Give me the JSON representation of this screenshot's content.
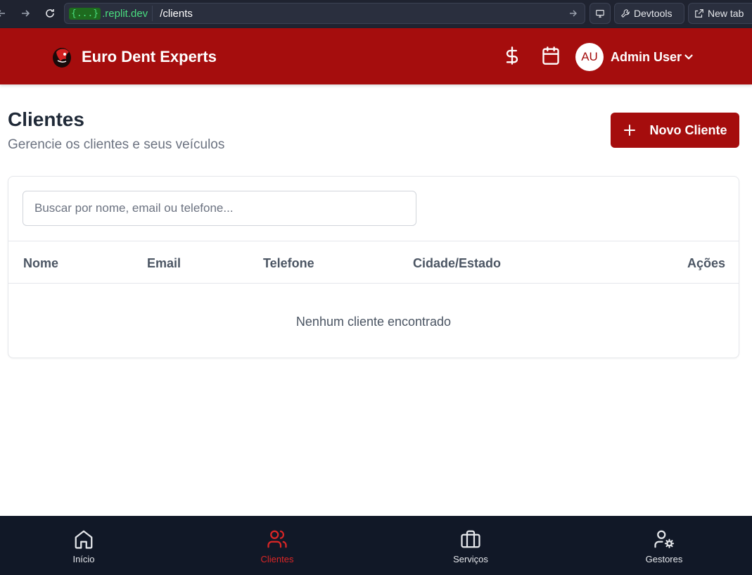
{
  "browser": {
    "url_host_braces": "{...}",
    "url_host_domain": ".replit.dev",
    "url_path": "/clients",
    "devtools_label": "Devtools",
    "new_tab_label": "New tab"
  },
  "header": {
    "brand_name": "Euro Dent Experts",
    "icons": [
      "dollar-icon",
      "calendar-icon"
    ],
    "avatar_initials": "AU",
    "user_name": "Admin User"
  },
  "page": {
    "title": "Clientes",
    "subtitle": "Gerencie os clientes e seus veículos",
    "new_button_label": "Novo Cliente"
  },
  "search": {
    "placeholder": "Buscar por nome, email ou telefone...",
    "value": ""
  },
  "table": {
    "columns": [
      "Nome",
      "Email",
      "Telefone",
      "Cidade/Estado",
      "Ações"
    ],
    "empty_message": "Nenhum cliente encontrado"
  },
  "bottom_nav": {
    "items": [
      {
        "label": "Início",
        "icon": "home-icon"
      },
      {
        "label": "Clientes",
        "icon": "users-icon"
      },
      {
        "label": "Serviços",
        "icon": "briefcase-icon"
      },
      {
        "label": "Gestores",
        "icon": "user-cog-icon"
      }
    ],
    "active_index": 1
  },
  "colors": {
    "brand_red": "#a50d0d",
    "active_nav": "#dc2626",
    "nav_background": "#111827"
  }
}
